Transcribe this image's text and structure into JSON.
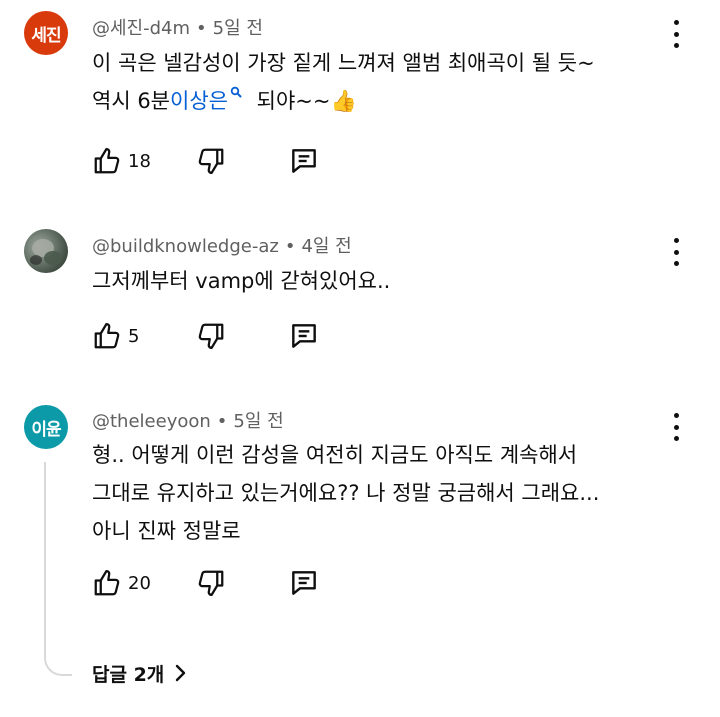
{
  "comments": [
    {
      "avatar_text": "세진",
      "avatar_color": "#d93a0b",
      "handle": "@세진-d4m",
      "time": "5일 전",
      "lines": [
        "이 곡은 넬감성이 가장 짙게 느껴져 앨범 최애곡이 될 듯~"
      ],
      "line2_prefix": "역시 6분",
      "line2_link": "이상은",
      "line2_suffix": "되야~~",
      "line2_emoji": "👍",
      "likes": "18"
    },
    {
      "avatar_text": "",
      "handle": "@buildknowledge-az",
      "time": "4일 전",
      "lines": [
        "그저께부터 vamp에 갇혀있어요.."
      ],
      "likes": "5"
    },
    {
      "avatar_text": "이윤",
      "avatar_color": "#0c9aa8",
      "handle": "@theleeyoon",
      "time": "5일 전",
      "lines": [
        "형.. 어떻게 이런 감성을 여전히 지금도 아직도 계속해서",
        "그대로 유지하고 있는거에요?? 나 정말 궁금해서 그래요...",
        "아니 진짜 정말로"
      ],
      "likes": "20",
      "replies_label": "답글 2개"
    }
  ],
  "icons": {
    "like": "thumbs-up-icon",
    "dislike": "thumbs-down-icon",
    "reply": "comment-reply-icon",
    "more": "more-vert-icon",
    "search": "search-icon",
    "chevron": "chevron-right-icon"
  },
  "colors": {
    "link": "#065fd4",
    "meta_text": "#606060",
    "text": "#0f0f0f"
  }
}
